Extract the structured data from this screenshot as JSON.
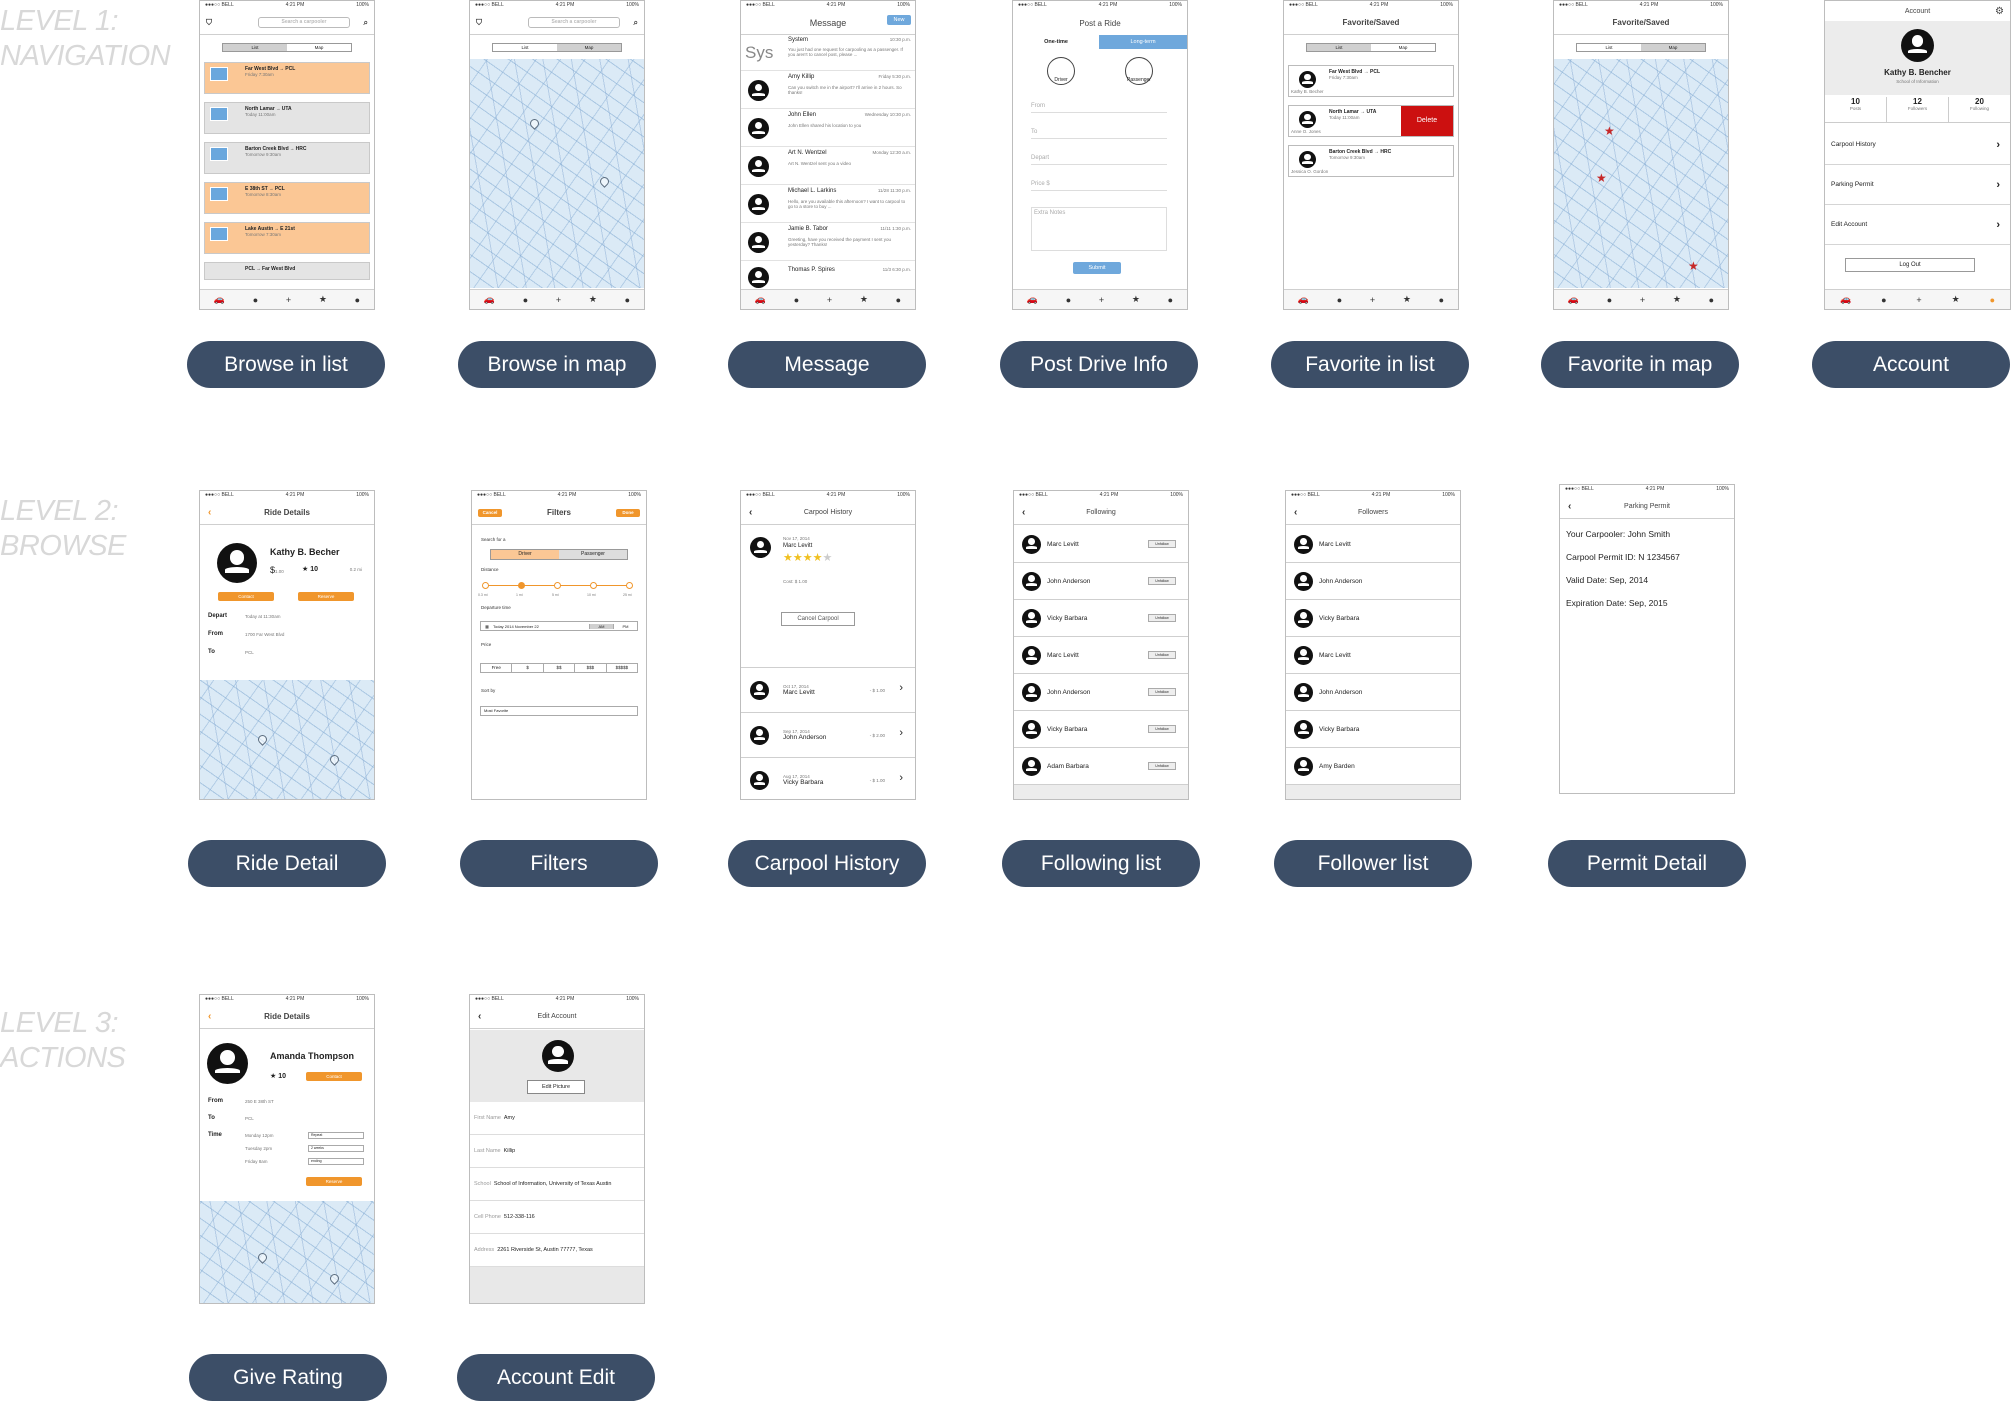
{
  "levels": [
    {
      "line1": "LEVEL 1:",
      "line2": "NAVIGATION"
    },
    {
      "line1": "LEVEL 2:",
      "line2": "BROWSE"
    },
    {
      "line1": "LEVEL 3:",
      "line2": "ACTIONS"
    }
  ],
  "status_bar": {
    "carrier": "●●●○○ BELL",
    "time": "4:21 PM",
    "battery": "100%"
  },
  "tabbar_icons": [
    "car-icon",
    "chat-icon",
    "plus-icon",
    "star-icon",
    "person-icon"
  ],
  "labels": {
    "browse_list": "Browse in list",
    "browse_map": "Browse in map",
    "message": "Message",
    "post_drive": "Post Drive Info",
    "fav_list": "Favorite in list",
    "fav_map": "Favorite in map",
    "account": "Account",
    "ride_detail": "Ride Detail",
    "filters": "Filters",
    "carpool_history": "Carpool History",
    "following_list": "Following list",
    "follower_list": "Follower list",
    "permit_detail": "Permit Detail",
    "give_rating": "Give Rating",
    "account_edit": "Account Edit"
  },
  "browse": {
    "search_placeholder": "Search a carpooler",
    "tab_list": "List",
    "tab_map": "Map",
    "rides": [
      {
        "from": "Far West Blvd",
        "to": "PCL",
        "when": "Friday 7:30am",
        "price": "$1.00",
        "dist": "0.2 mi",
        "color": "orange"
      },
      {
        "from": "North Lamar",
        "to": "UTA",
        "when": "Today 11:00am",
        "price": "$1.5",
        "dist": "1.3 mi",
        "color": "gray"
      },
      {
        "from": "Barton Creek Blvd",
        "to": "HRC",
        "when": "Tomorrow 9:30am",
        "price": "$2.00",
        "dist": "1.5 mi",
        "color": "gray"
      },
      {
        "from": "E 38th ST",
        "to": "PCL",
        "when": "Tomorrow 8:30am",
        "price": "$1",
        "dist": "0.8 mi",
        "color": "orange"
      },
      {
        "from": "Lake Austin",
        "to": "E 21st",
        "when": "Tomorrow 7:30am",
        "price": "$3",
        "dist": "2.4 mi",
        "color": "orange"
      },
      {
        "from": "PCL",
        "to": "Far West Blvd",
        "when": "",
        "price": "",
        "dist": "",
        "color": "gray"
      }
    ]
  },
  "message": {
    "title": "Message",
    "new_btn": "New",
    "system": {
      "name": "System",
      "time": "10:30 p.m.",
      "text": "You just had one request for carpooling as a passenger. If you aren't to cancel post, please ...",
      "badge": "Sys"
    },
    "rows": [
      {
        "name": "Amy Killip",
        "time": "Friday 5:30 p.m.",
        "text": "Can you switch me in the airport? I'll arrive in 2 hours. So thanks!"
      },
      {
        "name": "John Ellen",
        "time": "Wednesday 10:30 p.m.",
        "text": "John Ellen shared his location to you"
      },
      {
        "name": "Art N. Wentzel",
        "time": "Monday 12:30 a.m.",
        "text": "Art N. Wentzel sent you a video"
      },
      {
        "name": "Michael L. Larkins",
        "time": "11/28 11:30 p.m.",
        "text": "Hello, are you available this afternoon? I want to carpool to go to a store to buy ..."
      },
      {
        "name": "Jamie B. Tabor",
        "time": "11/11 1:30 p.m.",
        "text": "Greeting, have you received the payment I sent you yesterday? Thanks!"
      },
      {
        "name": "Thomas P. Spires",
        "time": "11/3 6:30 p.m.",
        "text": ""
      }
    ]
  },
  "post": {
    "title": "Post a Ride",
    "tab_one": "One-time",
    "tab_long": "Long-term",
    "driver": "Driver",
    "passenger": "Passenger",
    "fields": [
      "From",
      "To",
      "Depart",
      "Price $",
      "Extra Notes"
    ],
    "submit": "Submit"
  },
  "favorites": {
    "title": "Favorite/Saved",
    "tab_list": "List",
    "tab_map": "Map",
    "rows": [
      {
        "from": "Far West Blvd",
        "to": "PCL",
        "when": "Friday 7:30am",
        "name": "Kathy B. Becher"
      },
      {
        "from": "North Lamar",
        "to": "UTA",
        "when": "Today 11:00am",
        "name": "Anne O. Jones"
      },
      {
        "from": "Barton Creek Blvd",
        "to": "HRC",
        "when": "Tomorrow 9:30am",
        "name": "Jessica O. Gordon"
      }
    ],
    "delete": "Delete"
  },
  "account": {
    "title": "Account",
    "name": "Kathy B. Bencher",
    "school": "School of Information",
    "stats": [
      {
        "value": "10",
        "label": "Posts"
      },
      {
        "value": "12",
        "label": "Followers"
      },
      {
        "value": "20",
        "label": "Following"
      }
    ],
    "menu": [
      "Carpool History",
      "Parking Permit",
      "Edit Account"
    ],
    "logout": "Log Out"
  },
  "ride_detail": {
    "title": "Ride Details",
    "name": "Kathy B. Becher",
    "price": "$",
    "price_value": "1.00",
    "rating": "10",
    "dist": "0.2 mi",
    "contact": "Contact",
    "reserve": "Reserve",
    "depart_label": "Depart",
    "depart": "Today at 11:30am",
    "from_label": "From",
    "from": "1700 Far West Blvd",
    "to_label": "To",
    "to": "PCL"
  },
  "filters": {
    "title": "Filters",
    "cancel": "Cancel",
    "done": "Done",
    "search_for": "Search for a",
    "driver": "Driver",
    "passenger": "Passenger",
    "distance": "Distance",
    "ticks": [
      "0.3 mi",
      "1 mi",
      "5 mi",
      "10 mi",
      "25 mi"
    ],
    "departure_time": "Departure time",
    "date_value": "Today   2014 November 22",
    "am": "AM",
    "pm": "PM",
    "price": "Price",
    "price_opts": [
      "Free",
      "$",
      "$$",
      "$$$",
      "$$$$$"
    ],
    "sort_by": "Sort by",
    "sort_value": "Most Favorite"
  },
  "history": {
    "title": "Carpool History",
    "featured": {
      "date": "Nov 17, 2014",
      "name": "Marc Levitt",
      "cost": "Cost: $ 1.00"
    },
    "cancel": "Cancel Carpool",
    "rows": [
      {
        "date": "Oct 17, 2014",
        "name": "Marc Levitt",
        "amount": "- $ 1.00"
      },
      {
        "date": "Sep 17, 2014",
        "name": "John Anderson",
        "amount": "- $ 2.00"
      },
      {
        "date": "Aug 17, 2014",
        "name": "Vicky Barbara",
        "amount": "- $ 1.00"
      }
    ]
  },
  "following": {
    "title": "Following",
    "unfollow": "Unfollow",
    "names": [
      "Marc Levitt",
      "John Anderson",
      "Vicky Barbara",
      "Marc Levitt",
      "John Anderson",
      "Vicky Barbara",
      "Adam Barbara"
    ]
  },
  "followers": {
    "title": "Followers",
    "names": [
      "Marc Levitt",
      "John Anderson",
      "Vicky Barbara",
      "Marc Levitt",
      "John Anderson",
      "Vicky Barbara",
      "Amy Barden"
    ]
  },
  "permit": {
    "title": "Parking Permit",
    "lines": [
      "Your Carpooler: John Smith",
      "Carpool Permit ID: N 1234567",
      "Valid Date: Sep, 2014",
      "Expiration Date: Sep, 2015"
    ]
  },
  "rating": {
    "title": "Ride Details",
    "name": "Amanda Thompson",
    "score": "10",
    "contact": "Contact",
    "from_label": "From",
    "from": "250 E 38th ST",
    "to_label": "To",
    "to": "PCL",
    "time_label": "Time",
    "times": [
      {
        "day": "Monday 12pm",
        "val": "Repeat"
      },
      {
        "day": "Tuesday 2pm",
        "val": "2 weeks"
      },
      {
        "day": "Friday 8am",
        "val": "ending"
      }
    ],
    "reserve": "Reserve"
  },
  "edit": {
    "title": "Edit Account",
    "edit_picture": "Edit Picture",
    "fields": [
      {
        "label": "First Name",
        "value": "Amy"
      },
      {
        "label": "Last Name",
        "value": "Killip"
      },
      {
        "label": "School",
        "value": "School of Information, University of Texas Austin"
      },
      {
        "label": "Cell Phone",
        "value": "512-338-116"
      },
      {
        "label": "Address",
        "value": "2261 Riverside St, Austin 77777, Texas"
      }
    ]
  }
}
